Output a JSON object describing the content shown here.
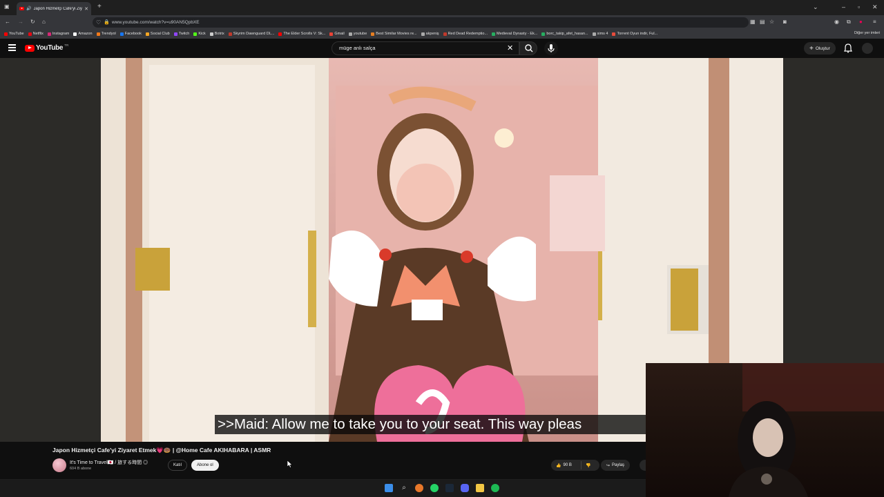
{
  "browser": {
    "tab_title": "Japon Hizmetçi Cafe'yi Ziya...",
    "url": "www.youtube.com/watch?v=u90AN5QpbXE",
    "bookmarks": [
      {
        "label": "YouTube",
        "color": "#ff0000"
      },
      {
        "label": "Netflix",
        "color": "#e50914"
      },
      {
        "label": "Instagram",
        "color": "#d62976"
      },
      {
        "label": "Amazon",
        "color": "#ffffff"
      },
      {
        "label": "Trendyol",
        "color": "#f27a1a"
      },
      {
        "label": "Facebook",
        "color": "#1877f2"
      },
      {
        "label": "Social Club",
        "color": "#f5a623"
      },
      {
        "label": "Twitch",
        "color": "#9146ff"
      },
      {
        "label": "Kick",
        "color": "#53fc18"
      },
      {
        "label": "Botrix",
        "color": "#cccccc"
      },
      {
        "label": "Skyrim Dawnguard DL...",
        "color": "#c0392b"
      },
      {
        "label": "The Elder Scrolls V: Sk...",
        "color": "#ff0000"
      },
      {
        "label": "Gmail",
        "color": "#ea4335"
      },
      {
        "label": "youtube",
        "color": "#aaaaaa"
      },
      {
        "label": "Best Similar Movies re...",
        "color": "#e67e22"
      },
      {
        "label": "akpeniş",
        "color": "#aaaaaa"
      },
      {
        "label": "Red Dead Redemptio...",
        "color": "#c0392b"
      },
      {
        "label": "Medieval Dynasty - Ek...",
        "color": "#27ae60"
      },
      {
        "label": "borc_takip_afet_hasan...",
        "color": "#27ae60"
      },
      {
        "label": "sims 4",
        "color": "#aaaaaa"
      },
      {
        "label": "Torrent Oyun indir, Ful...",
        "color": "#e74c3c"
      }
    ],
    "other_bookmarks": "Diğer yer imleri"
  },
  "masthead": {
    "logo_text": "YouTube",
    "country_code": "TR",
    "search_value": "müge anlı salça",
    "create_label": "Oluştur"
  },
  "video": {
    "caption": ">>Maid: Allow me to take you to your seat. This way pleas",
    "title": "Japon Hizmetçi Cafe'yi Ziyaret Etmek💗🍩 | @Home Cafe AKIHABARA | ASMR",
    "channel_name": "It's Time to Travel🇯🇵 / 旅する時間 ◎",
    "subscribers": "604 B abone",
    "join_label": "Katıl",
    "subscribe_label": "Abone ol",
    "likes": "90 B",
    "share_label": "Paylaş"
  },
  "colors": {
    "youtube_red": "#ff0000",
    "background": "#0f0f0f"
  }
}
